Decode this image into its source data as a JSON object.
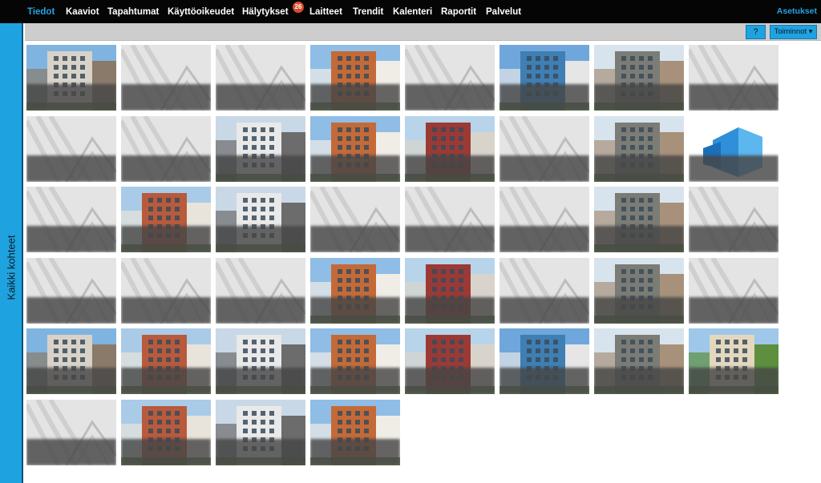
{
  "nav": {
    "items": [
      {
        "label": "Tiedot",
        "active": true
      },
      {
        "label": "Kaaviot"
      },
      {
        "label": "Tapahtumat"
      },
      {
        "label": "Käyttöoikeudet"
      },
      {
        "label": "Hälytykset"
      },
      {
        "label": "Laitteet"
      },
      {
        "label": "Trendit"
      },
      {
        "label": "Kalenteri"
      },
      {
        "label": "Raportit"
      },
      {
        "label": "Palvelut"
      }
    ],
    "alarm_badge": "26",
    "settings": "Asetukset"
  },
  "side_tab": "Kaikki kohteet",
  "toolbar": {
    "help": "?",
    "actions": "Toiminnot ▾"
  },
  "tiles": [
    {
      "caption": "",
      "image": "photo-building"
    },
    {
      "caption": "",
      "image": "placeholder"
    },
    {
      "caption": "",
      "image": "placeholder"
    },
    {
      "caption": "",
      "image": "photo-building"
    },
    {
      "caption": "",
      "image": "placeholder"
    },
    {
      "caption": "",
      "image": "photo-building"
    },
    {
      "caption": "",
      "image": "photo-building"
    },
    {
      "caption": "",
      "image": "placeholder"
    },
    {
      "caption": "",
      "image": "placeholder"
    },
    {
      "caption": "",
      "image": "placeholder"
    },
    {
      "caption": "",
      "image": "photo-building"
    },
    {
      "caption": "",
      "image": "photo-building"
    },
    {
      "caption": "",
      "image": "photo-building"
    },
    {
      "caption": "",
      "image": "placeholder"
    },
    {
      "caption": "",
      "image": "photo-building"
    },
    {
      "caption": "",
      "image": "illustration-building"
    },
    {
      "caption": "",
      "image": "placeholder"
    },
    {
      "caption": "",
      "image": "photo-building"
    },
    {
      "caption": "",
      "image": "photo-building"
    },
    {
      "caption": "",
      "image": "placeholder"
    },
    {
      "caption": "",
      "image": "placeholder"
    },
    {
      "caption": "",
      "image": "placeholder"
    },
    {
      "caption": "",
      "image": "photo-building"
    },
    {
      "caption": "",
      "image": "placeholder"
    },
    {
      "caption": "",
      "image": "placeholder"
    },
    {
      "caption": "",
      "image": "placeholder"
    },
    {
      "caption": "",
      "image": "placeholder"
    },
    {
      "caption": "",
      "image": "photo-building"
    },
    {
      "caption": "",
      "image": "photo-building"
    },
    {
      "caption": "",
      "image": "placeholder"
    },
    {
      "caption": "",
      "image": "photo-building"
    },
    {
      "caption": "",
      "image": "placeholder"
    },
    {
      "caption": "",
      "image": "photo-building"
    },
    {
      "caption": "",
      "image": "photo-building"
    },
    {
      "caption": "",
      "image": "photo-building"
    },
    {
      "caption": "",
      "image": "photo-building"
    },
    {
      "caption": "",
      "image": "photo-building"
    },
    {
      "caption": "",
      "image": "photo-building"
    },
    {
      "caption": "",
      "image": "photo-building"
    },
    {
      "caption": "",
      "image": "photo-building"
    },
    {
      "caption": "",
      "image": "placeholder"
    },
    {
      "caption": "",
      "image": "photo-building"
    },
    {
      "caption": "",
      "image": "photo-building"
    },
    {
      "caption": "",
      "image": "photo-building"
    }
  ],
  "colors": {
    "nav_bg": "#050505",
    "accent": "#1fa3e0",
    "badge": "#d9492b",
    "toolbar_bg": "#cdcdcd"
  }
}
